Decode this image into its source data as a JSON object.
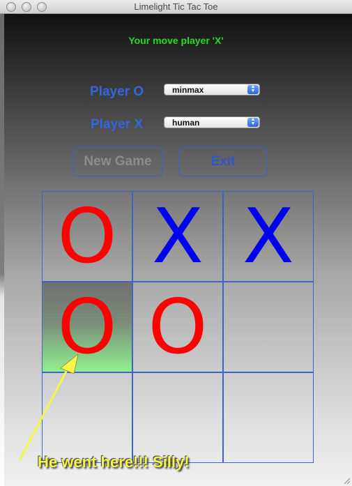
{
  "window": {
    "title": "Limelight Tic Tac Toe"
  },
  "status": "Your move player 'X'",
  "players": [
    {
      "label": "Player O",
      "selected": "minmax"
    },
    {
      "label": "Player X",
      "selected": "human"
    }
  ],
  "buttons": {
    "new_game": "New Game",
    "exit": "Exit"
  },
  "board": [
    [
      "O",
      "X",
      "X"
    ],
    [
      "O",
      "O",
      ""
    ],
    [
      "",
      "",
      ""
    ]
  ],
  "annotation": "He went here!!! Silly!",
  "colors": {
    "o_mark": "#ff0000",
    "x_mark": "#0000ee",
    "status_text": "#22dd22",
    "label_text": "#3366dd",
    "highlight": "#90ee90",
    "annotation_text": "#f5f54a"
  }
}
